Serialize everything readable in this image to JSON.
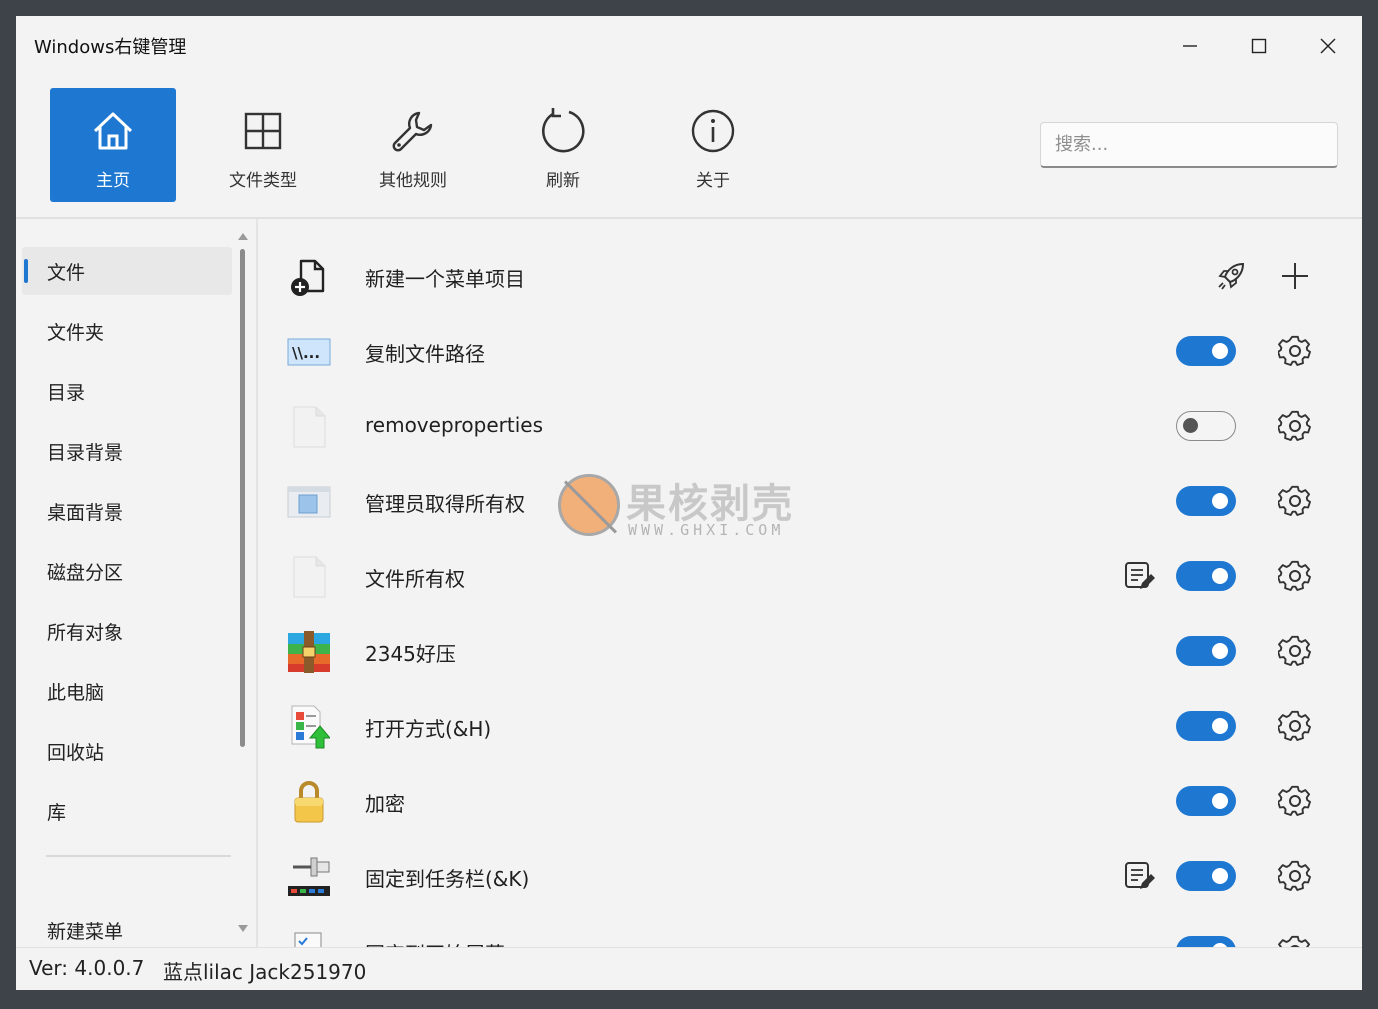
{
  "window": {
    "title": "Windows右键管理"
  },
  "toolbar": {
    "items": [
      {
        "label": "主页",
        "icon": "home-icon",
        "active": true
      },
      {
        "label": "文件类型",
        "icon": "grid-icon",
        "active": false
      },
      {
        "label": "其他规则",
        "icon": "wrench-icon",
        "active": false
      },
      {
        "label": "刷新",
        "icon": "refresh-icon",
        "active": false
      },
      {
        "label": "关于",
        "icon": "info-icon",
        "active": false
      }
    ],
    "search_placeholder": "搜索..."
  },
  "sidebar": {
    "items": [
      {
        "label": "文件",
        "selected": true
      },
      {
        "label": "文件夹"
      },
      {
        "label": "目录"
      },
      {
        "label": "目录背景"
      },
      {
        "label": "桌面背景"
      },
      {
        "label": "磁盘分区"
      },
      {
        "label": "所有对象"
      },
      {
        "label": "此电脑"
      },
      {
        "label": "回收站"
      },
      {
        "label": "库"
      }
    ],
    "bottom_item": "新建菜单"
  },
  "list": {
    "rows": [
      {
        "label": "新建一个菜单项目",
        "icon": "new-file-icon"
      },
      {
        "label": "复制文件路径",
        "icon": "path-icon",
        "enabled": true
      },
      {
        "label": "removeproperties",
        "icon": "blank-file-icon",
        "enabled": false
      },
      {
        "label": "管理员取得所有权",
        "icon": "window-app-icon",
        "enabled": true
      },
      {
        "label": "文件所有权",
        "icon": "blank-file-icon",
        "enabled": true,
        "has_edit": true
      },
      {
        "label": "2345好压",
        "icon": "archive-icon",
        "enabled": true
      },
      {
        "label": "打开方式(&H)",
        "icon": "open-with-icon",
        "enabled": true
      },
      {
        "label": "加密",
        "icon": "lock-icon",
        "enabled": true
      },
      {
        "label": "固定到任务栏(&K)",
        "icon": "pin-taskbar-icon",
        "enabled": true,
        "has_edit": true
      },
      {
        "label": "固定到开始屏幕",
        "icon": "checklist-icon",
        "enabled": true
      }
    ]
  },
  "watermark": {
    "title": "果核剥壳",
    "subtitle": "WWW.GHXI.COM"
  },
  "status": {
    "version": "Ver: 4.0.0.7",
    "authors": "蓝点lilac Jack251970"
  },
  "colors": {
    "accent": "#1e78d2",
    "background": "#f3f3f3"
  }
}
